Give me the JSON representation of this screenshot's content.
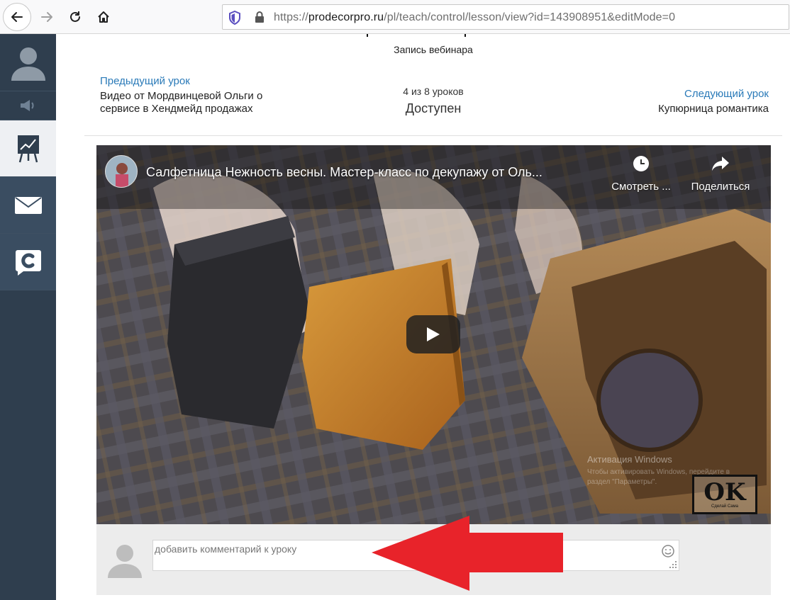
{
  "browser": {
    "url_scheme": "https://",
    "url_host": "prodecorpro.ru",
    "url_path": "/pl/teach/control/lesson/view?id=143908951&editMode=0"
  },
  "sidebar": {
    "items": [
      {
        "icon": "user-avatar-icon"
      },
      {
        "icon": "speaker-icon"
      },
      {
        "icon": "chart-board-icon",
        "active": true
      },
      {
        "icon": "mail-icon"
      },
      {
        "icon": "chat-icon"
      }
    ]
  },
  "lesson": {
    "subtitle": "Запись вебинара",
    "prev_link": "Предыдущий урок",
    "prev_title": "Видео от Мордвинцевой Ольги о сервисе в Хендмейд продажах",
    "counter": "4 из 8 уроков",
    "status": "Доступен",
    "next_link": "Следующий урок",
    "next_title": "Купюрница романтика"
  },
  "video": {
    "title": "Салфетница Нежность весны. Мастер-класс по декупажу от Оль...",
    "watch_later": "Смотреть ...",
    "share": "Поделиться",
    "watermark_title": "Активация Windows",
    "watermark_sub": "Чтобы активировать Windows, перейдите в раздел \"Параметры\".",
    "logo_text": "OK",
    "logo_sub": "Сделай Сама"
  },
  "comment": {
    "placeholder": "добавить комментарий к уроку"
  },
  "colors": {
    "sidebar_bg": "#2f3e4e",
    "link": "#2a7ab8",
    "arrow": "#e8232a"
  }
}
